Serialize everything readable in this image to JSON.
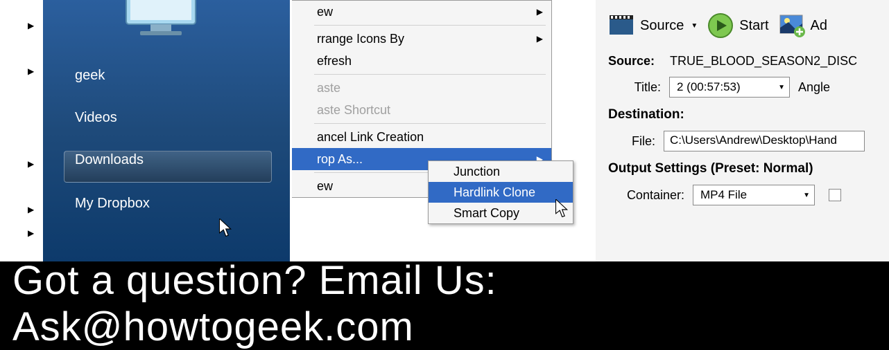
{
  "panel1": {
    "items": [
      "geek",
      "Videos",
      "Downloads",
      "My Dropbox"
    ],
    "highlighted_index": 3
  },
  "panel2": {
    "menu": [
      {
        "label": "ew",
        "submenu": true
      },
      {
        "sep": true
      },
      {
        "label": "rrange Icons By",
        "submenu": true
      },
      {
        "label": "efresh"
      },
      {
        "sep": true
      },
      {
        "label": "aste",
        "disabled": true
      },
      {
        "label": "aste Shortcut",
        "disabled": true
      },
      {
        "sep": true
      },
      {
        "label": "ancel Link Creation"
      },
      {
        "label": "rop As...",
        "submenu": true,
        "selected": true
      },
      {
        "sep": true
      },
      {
        "label": "ew",
        "submenu": true
      }
    ],
    "submenu": [
      {
        "label": "Junction"
      },
      {
        "label": "Hardlink Clone",
        "selected": true
      },
      {
        "label": "Smart Copy"
      }
    ]
  },
  "panel3": {
    "toolbar": {
      "source_label": "Source",
      "start_label": "Start",
      "add_label": "Ad"
    },
    "source_label": "Source:",
    "source_value": "TRUE_BLOOD_SEASON2_DISC",
    "title_label": "Title:",
    "title_value": "2 (00:57:53)",
    "angle_label": "Angle",
    "destination_heading": "Destination:",
    "file_label": "File:",
    "file_value": "C:\\Users\\Andrew\\Desktop\\Hand",
    "output_heading": "Output Settings (Preset: Normal)",
    "container_label": "Container:",
    "container_value": "MP4 File"
  },
  "footer": {
    "text": "Got a question? Email Us: Ask@howtogeek.com"
  }
}
